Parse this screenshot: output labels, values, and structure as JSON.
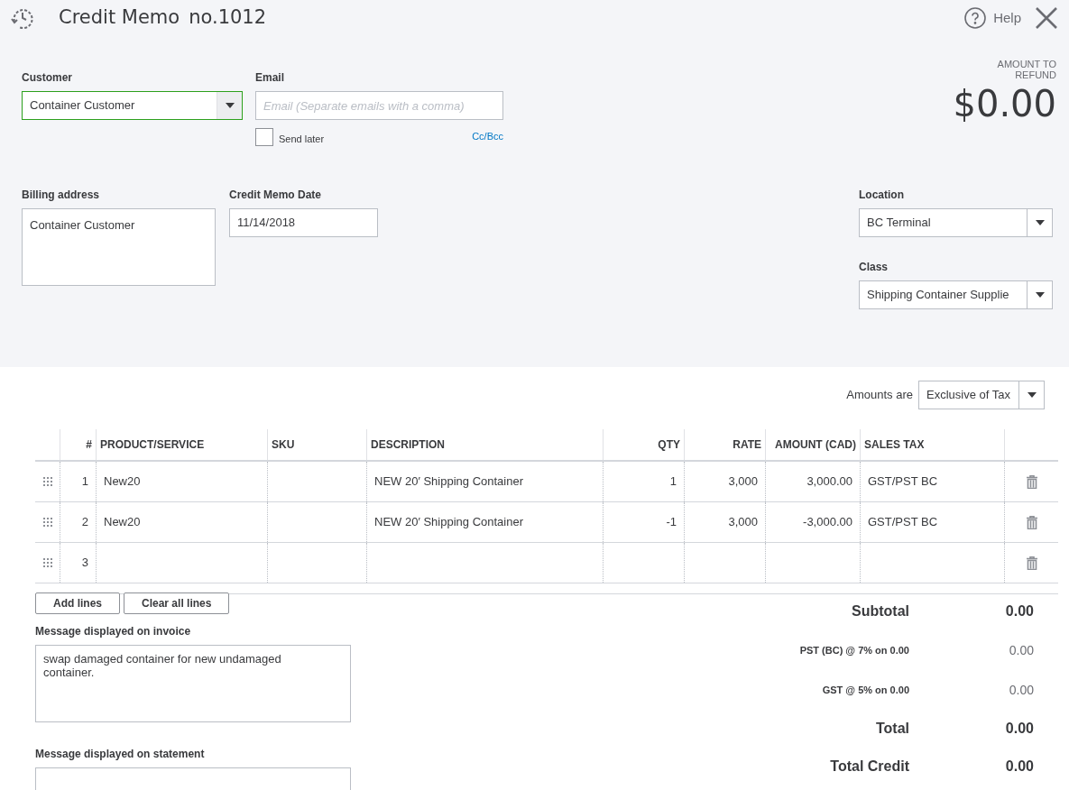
{
  "header": {
    "title": "Credit Memo",
    "number": "no.1012",
    "help": "Help"
  },
  "customer": {
    "label": "Customer",
    "value": "Container Customer",
    "focused": true
  },
  "email": {
    "label": "Email",
    "placeholder": "Email (Separate emails with a comma)",
    "send_later": {
      "label": "Send later",
      "checked": false
    },
    "cc_link": "Cc/Bcc"
  },
  "amount": {
    "label": "AMOUNT TO REFUND",
    "value": "$0.00"
  },
  "billing_address": {
    "label": "Billing address",
    "value": "Container Customer"
  },
  "date": {
    "label": "Credit Memo Date",
    "value": "11/14/2018"
  },
  "location": {
    "label": "Location",
    "value": "BC Terminal"
  },
  "class": {
    "label": "Class",
    "value": "Shipping Container Supplie"
  },
  "amounts_are": {
    "label": "Amounts are",
    "value": "Exclusive of Tax"
  },
  "table": {
    "columns": [
      "#",
      "PRODUCT/SERVICE",
      "SKU",
      "DESCRIPTION",
      "QTY",
      "RATE",
      "AMOUNT (CAD)",
      "SALES TAX"
    ],
    "rows": [
      {
        "number": "1",
        "product": "New20",
        "description": "NEW 20′ Shipping Container",
        "qty": "1",
        "rate": "3,000",
        "amount": "3,000.00",
        "tax": "GST/PST BC"
      },
      {
        "number": "2",
        "product": "New20",
        "description": "NEW 20′ Shipping Container",
        "qty": "-1",
        "rate": "3,000",
        "amount": "-3,000.00",
        "tax": "GST/PST BC"
      },
      {
        "number": "3"
      }
    ]
  },
  "buttons": [
    "Add lines",
    "Clear all lines"
  ],
  "invoice_message": {
    "label": "Message displayed on invoice",
    "value": "swap damaged container for new undamaged container."
  },
  "statement_message": {
    "label": "Message displayed on statement"
  },
  "totals": [
    {
      "kind": "main",
      "label": "Subtotal",
      "value": "0.00"
    },
    {
      "kind": "tax",
      "label": "PST (BC) @ 7% on 0.00",
      "value": "0.00"
    },
    {
      "kind": "tax",
      "label": "GST @ 5% on 0.00",
      "value": "0.00"
    },
    {
      "kind": "main",
      "label": "Total",
      "value": "0.00"
    },
    {
      "kind": "main",
      "label": "Total Credit",
      "value": "0.00"
    }
  ]
}
